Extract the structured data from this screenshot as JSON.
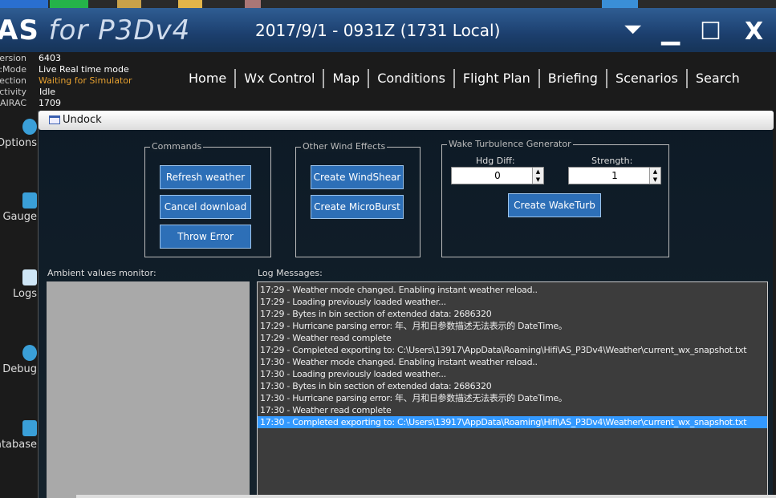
{
  "title": {
    "logo_bold": "AS",
    "logo_rest": " for P3Dv4",
    "datetime": "2017/9/1 - 0931Z (1731 Local)"
  },
  "window_controls": {
    "menu": "⏷",
    "minimize": "▁",
    "maximize": "☐",
    "close": "X"
  },
  "info": [
    {
      "key": "Version:",
      "value": "6403"
    },
    {
      "key": "Mode:",
      "value": "Live Real time mode"
    },
    {
      "key": "Connection:",
      "value": "Waiting for Simulator",
      "color": "#e6a030"
    },
    {
      "key": "Activity:",
      "value": "Idle"
    },
    {
      "key": "AIRAC:",
      "value": "1709"
    }
  ],
  "nav": [
    "Home",
    "Wx Control",
    "Map",
    "Conditions",
    "Flight Plan",
    "Briefing",
    "Scenarios",
    "Search"
  ],
  "sidebar": [
    {
      "label": "Options",
      "icon": "gear-icon"
    },
    {
      "label": "Gauge",
      "icon": "gauge-icon"
    },
    {
      "label": "Logs",
      "icon": "logs-icon"
    },
    {
      "label": "Debug",
      "icon": "debug-icon"
    },
    {
      "label": "Database",
      "icon": "database-icon"
    }
  ],
  "panel": {
    "undock": "Undock"
  },
  "commands": {
    "legend": "Commands",
    "refresh": "Refresh weather",
    "cancel": "Cancel download",
    "throw": "Throw Error"
  },
  "wind": {
    "legend": "Other Wind Effects",
    "windshear": "Create WindShear",
    "microburst": "Create MicroBurst"
  },
  "wake": {
    "legend": "Wake Turbulence Generator",
    "hdg_label": "Hdg Diff:",
    "hdg_value": "0",
    "strength_label": "Strength:",
    "strength_value": "1",
    "create": "Create WakeTurb"
  },
  "ambient": {
    "label": "Ambient values monitor:"
  },
  "log": {
    "label": "Log Messages:",
    "selected_index": 11,
    "lines": [
      "17:29 - Weather mode changed. Enabling instant weather reload..",
      "17:29 - Loading previously loaded weather...",
      "17:29 - Bytes in bin section of extended data: 2686320",
      "17:29 - Hurricane parsing error: 年、月和日参数描述无法表示的 DateTime。",
      "17:29 - Weather read complete",
      "17:29 - Completed exporting to: C:\\Users\\13917\\AppData\\Roaming\\Hifi\\AS_P3Dv4\\Weather\\current_wx_snapshot.txt",
      "17:30 - Weather mode changed. Enabling instant weather reload..",
      "17:30 - Loading previously loaded weather...",
      "17:30 - Bytes in bin section of extended data: 2686320",
      "17:30 - Hurricane parsing error: 年、月和日参数描述无法表示的 DateTime。",
      "17:30 - Weather read complete",
      "17:30 - Completed exporting to: C:\\Users\\13917\\AppData\\Roaming\\Hifi\\AS_P3Dv4\\Weather\\current_wx_snapshot.txt"
    ]
  }
}
